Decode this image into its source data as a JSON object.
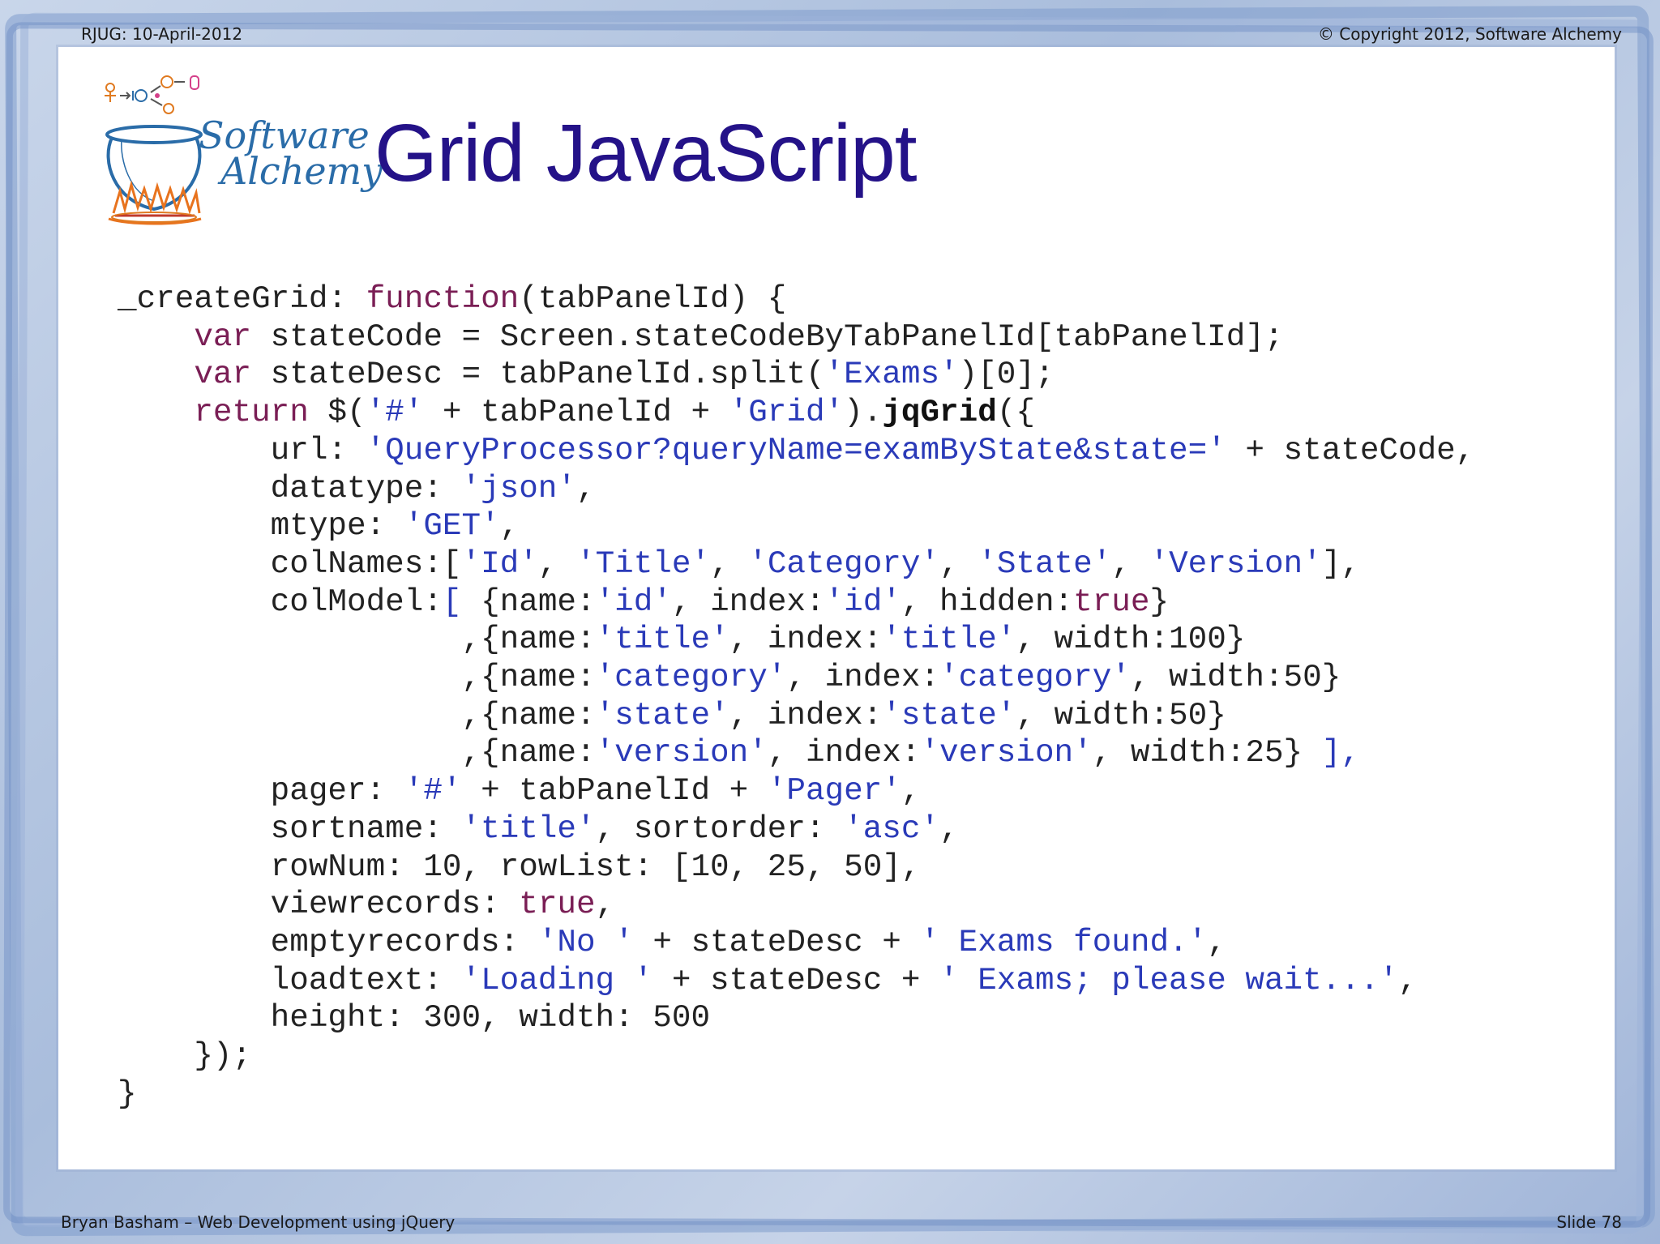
{
  "header": {
    "left": "RJUG:  10-April-2012",
    "right": "© Copyright 2012, Software Alchemy"
  },
  "logo": {
    "word1": "Software",
    "word2": "Alchemy"
  },
  "slide": {
    "title": "Grid JavaScript"
  },
  "code_lines": [
    [
      [
        "_createGrid: ",
        "t"
      ],
      [
        "function",
        "kw"
      ],
      [
        "(tabPanelId) {",
        "t"
      ]
    ],
    [
      [
        "    ",
        "t"
      ],
      [
        "var",
        "kw"
      ],
      [
        " stateCode = Screen.stateCodeByTabPanelId[tabPanelId];",
        "t"
      ]
    ],
    [
      [
        "    ",
        "t"
      ],
      [
        "var",
        "kw"
      ],
      [
        " stateDesc = tabPanelId.split(",
        "t"
      ],
      [
        "'Exams'",
        "str"
      ],
      [
        ")[0];",
        "t"
      ]
    ],
    [
      [
        "    ",
        "t"
      ],
      [
        "return",
        "kw"
      ],
      [
        " $(",
        "t"
      ],
      [
        "'#'",
        "str"
      ],
      [
        " + tabPanelId + ",
        "t"
      ],
      [
        "'Grid'",
        "str"
      ],
      [
        ").",
        "t"
      ],
      [
        "jqGrid",
        "b"
      ],
      [
        "({",
        "t"
      ]
    ],
    [
      [
        "        url: ",
        "t"
      ],
      [
        "'QueryProcessor?queryName=examByState&state='",
        "str"
      ],
      [
        " + stateCode,",
        "t"
      ]
    ],
    [
      [
        "        datatype: ",
        "t"
      ],
      [
        "'json'",
        "str"
      ],
      [
        ",",
        "t"
      ]
    ],
    [
      [
        "        mtype: ",
        "t"
      ],
      [
        "'GET'",
        "str"
      ],
      [
        ",",
        "t"
      ]
    ],
    [
      [
        "        colNames:[",
        "t"
      ],
      [
        "'Id'",
        "str"
      ],
      [
        ", ",
        "t"
      ],
      [
        "'Title'",
        "str"
      ],
      [
        ", ",
        "t"
      ],
      [
        "'Category'",
        "str"
      ],
      [
        ", ",
        "t"
      ],
      [
        "'State'",
        "str"
      ],
      [
        ", ",
        "t"
      ],
      [
        "'Version'",
        "str"
      ],
      [
        "],",
        "t"
      ]
    ],
    [
      [
        "        colModel:",
        "t"
      ],
      [
        "[",
        "str"
      ],
      [
        " {name:",
        "t"
      ],
      [
        "'id'",
        "str"
      ],
      [
        ", index:",
        "t"
      ],
      [
        "'id'",
        "str"
      ],
      [
        ", hidden:",
        "t"
      ],
      [
        "true",
        "kw"
      ],
      [
        "}",
        "t"
      ]
    ],
    [
      [
        "                  ,{name:",
        "t"
      ],
      [
        "'title'",
        "str"
      ],
      [
        ", index:",
        "t"
      ],
      [
        "'title'",
        "str"
      ],
      [
        ", width:100}",
        "t"
      ]
    ],
    [
      [
        "                  ,{name:",
        "t"
      ],
      [
        "'category'",
        "str"
      ],
      [
        ", index:",
        "t"
      ],
      [
        "'category'",
        "str"
      ],
      [
        ", width:50}",
        "t"
      ]
    ],
    [
      [
        "                  ,{name:",
        "t"
      ],
      [
        "'state'",
        "str"
      ],
      [
        ", index:",
        "t"
      ],
      [
        "'state'",
        "str"
      ],
      [
        ", width:50}",
        "t"
      ]
    ],
    [
      [
        "                  ,{name:",
        "t"
      ],
      [
        "'version'",
        "str"
      ],
      [
        ", index:",
        "t"
      ],
      [
        "'version'",
        "str"
      ],
      [
        ", width:25} ",
        "t"
      ],
      [
        "],",
        "str"
      ]
    ],
    [
      [
        "        pager: ",
        "t"
      ],
      [
        "'#'",
        "str"
      ],
      [
        " + tabPanelId + ",
        "t"
      ],
      [
        "'Pager'",
        "str"
      ],
      [
        ",",
        "t"
      ]
    ],
    [
      [
        "        sortname: ",
        "t"
      ],
      [
        "'title'",
        "str"
      ],
      [
        ", sortorder: ",
        "t"
      ],
      [
        "'asc'",
        "str"
      ],
      [
        ",",
        "t"
      ]
    ],
    [
      [
        "        rowNum: 10, rowList: [10, 25, 50],",
        "t"
      ]
    ],
    [
      [
        "        viewrecords: ",
        "t"
      ],
      [
        "true",
        "kw"
      ],
      [
        ",",
        "t"
      ]
    ],
    [
      [
        "        emptyrecords: ",
        "t"
      ],
      [
        "'No '",
        "str"
      ],
      [
        " + stateDesc + ",
        "t"
      ],
      [
        "' Exams found.'",
        "str"
      ],
      [
        ",",
        "t"
      ]
    ],
    [
      [
        "        loadtext: ",
        "t"
      ],
      [
        "'Loading '",
        "str"
      ],
      [
        " + stateDesc + ",
        "t"
      ],
      [
        "' Exams; please wait...'",
        "str"
      ],
      [
        ",",
        "t"
      ]
    ],
    [
      [
        "        height: 300, width: 500",
        "t"
      ]
    ],
    [
      [
        "    });",
        "t"
      ]
    ],
    [
      [
        "}",
        "t"
      ]
    ]
  ],
  "footer": {
    "left": "Bryan Basham – Web Development using jQuery",
    "right": "Slide 78"
  }
}
